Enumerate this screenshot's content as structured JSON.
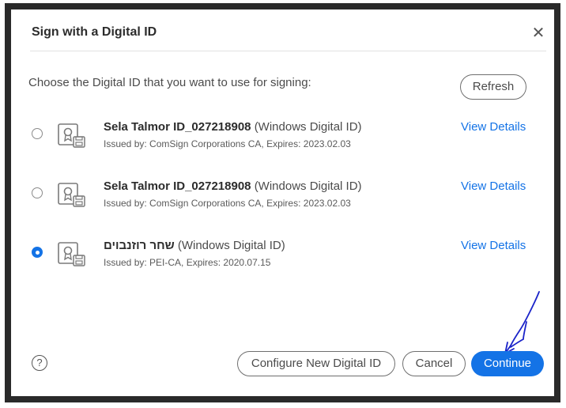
{
  "dialog": {
    "title": "Sign with a Digital ID",
    "close_icon": "close-icon",
    "prompt": "Choose the Digital ID that you want to use for signing:",
    "refresh_label": "Refresh"
  },
  "ids": [
    {
      "name": "Sela Talmor ID_027218908",
      "type": "(Windows Digital ID)",
      "issued": "Issued by: ComSign Corporations CA, Expires: 2023.02.03",
      "view_details": "View Details",
      "selected": false
    },
    {
      "name": "Sela Talmor ID_027218908",
      "type": "(Windows Digital ID)",
      "issued": "Issued by: ComSign Corporations CA, Expires: 2023.02.03",
      "view_details": "View Details",
      "selected": false
    },
    {
      "name": "שחר רוזנבוים",
      "type": "(Windows Digital ID)",
      "issued": "Issued by: PEI-CA, Expires: 2020.07.15",
      "view_details": "View Details",
      "selected": true
    }
  ],
  "footer": {
    "help_label": "?",
    "configure_label": "Configure New Digital ID",
    "cancel_label": "Cancel",
    "continue_label": "Continue"
  },
  "colors": {
    "accent": "#1473e6",
    "annotation": "#1a23c9"
  }
}
